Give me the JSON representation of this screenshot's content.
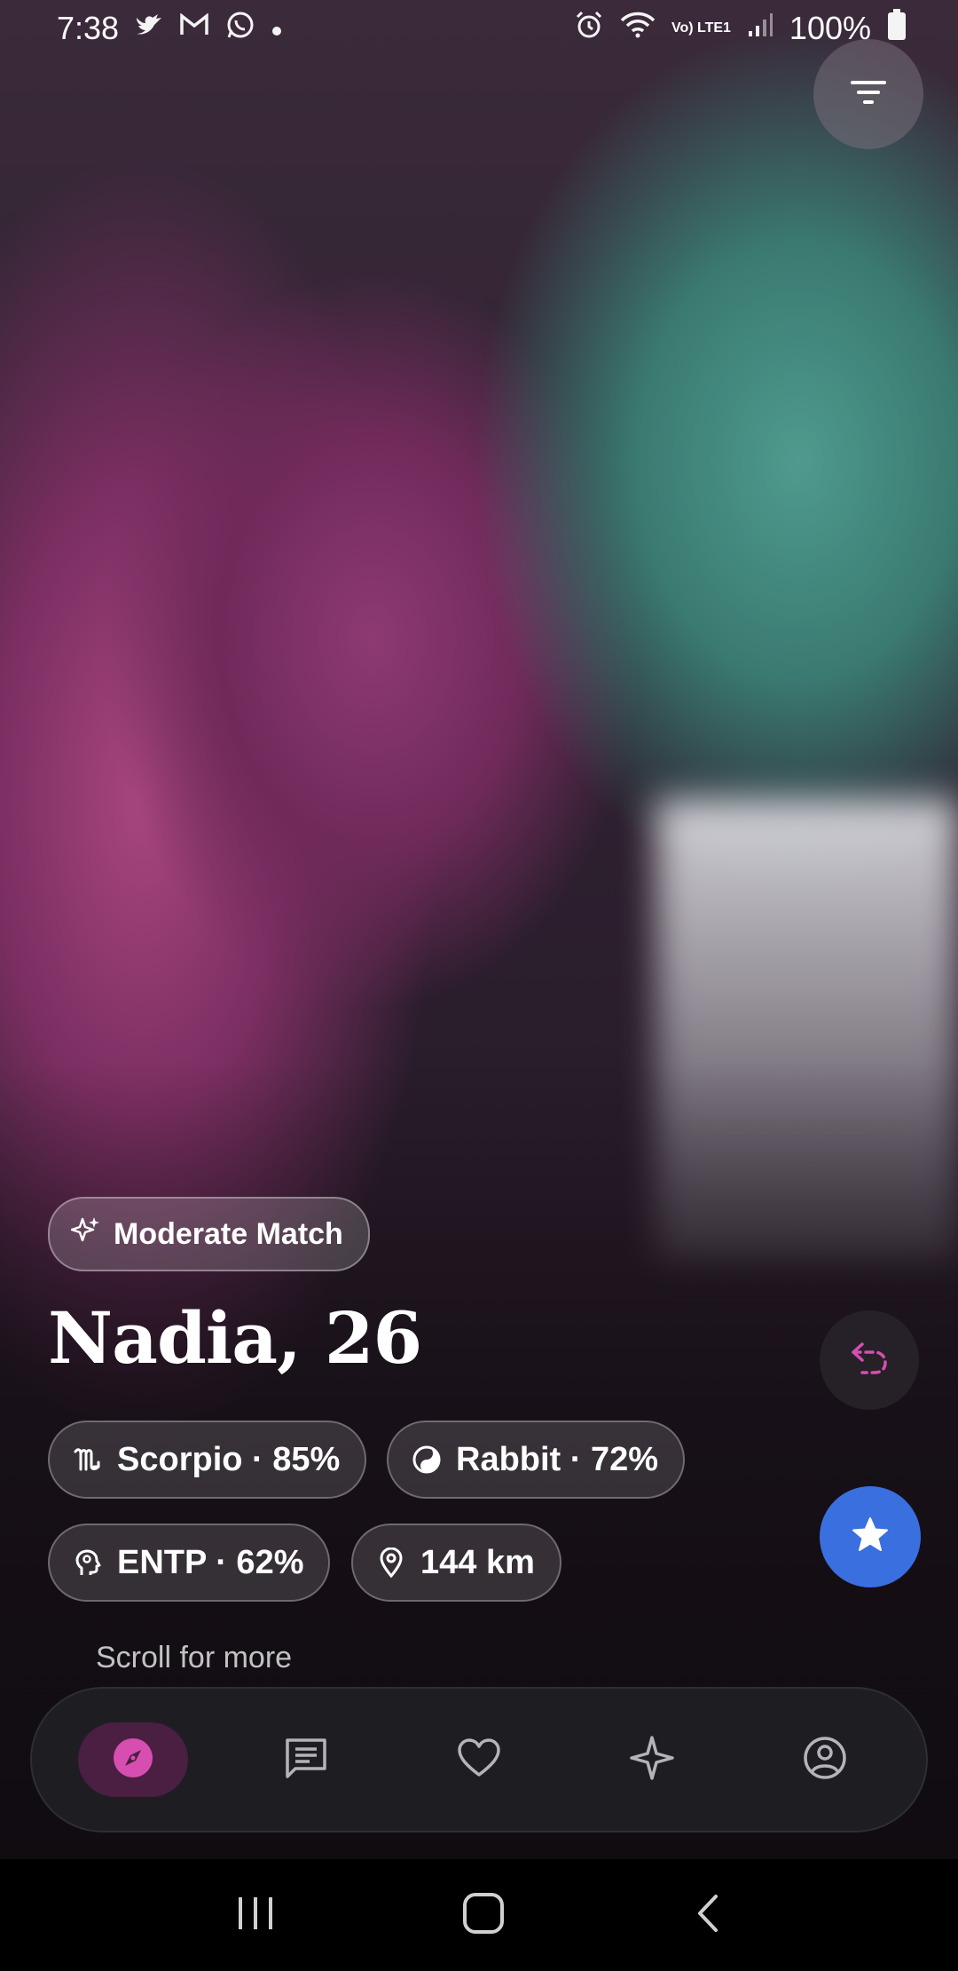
{
  "status_bar": {
    "time": "7:38",
    "battery": "100%",
    "network_label": "Vo) LTE1",
    "icons": [
      "twitter-icon",
      "gmail-icon",
      "whatsapp-icon",
      "dot-icon",
      "alarm-icon",
      "wifi-icon",
      "signal-icon",
      "battery-icon"
    ]
  },
  "profile": {
    "match_label": "Moderate Match",
    "name_age": "Nadia, 26",
    "chips": [
      {
        "icon": "scorpio-icon",
        "label": "Scorpio · 85%"
      },
      {
        "icon": "yin-yang-icon",
        "label": "Rabbit · 72%"
      },
      {
        "icon": "brain-head-icon",
        "label": "ENTP · 62%"
      },
      {
        "icon": "location-pin-icon",
        "label": "144 km"
      }
    ],
    "scroll_hint": "Scroll for more"
  },
  "nav": {
    "items": [
      "discover",
      "messages",
      "likes",
      "sparkle",
      "profile"
    ],
    "active": "discover"
  },
  "colors": {
    "accent_pink": "#d64fb0",
    "star_button": "#3a6fe0",
    "active_nav_bg": "#4a1f42"
  }
}
